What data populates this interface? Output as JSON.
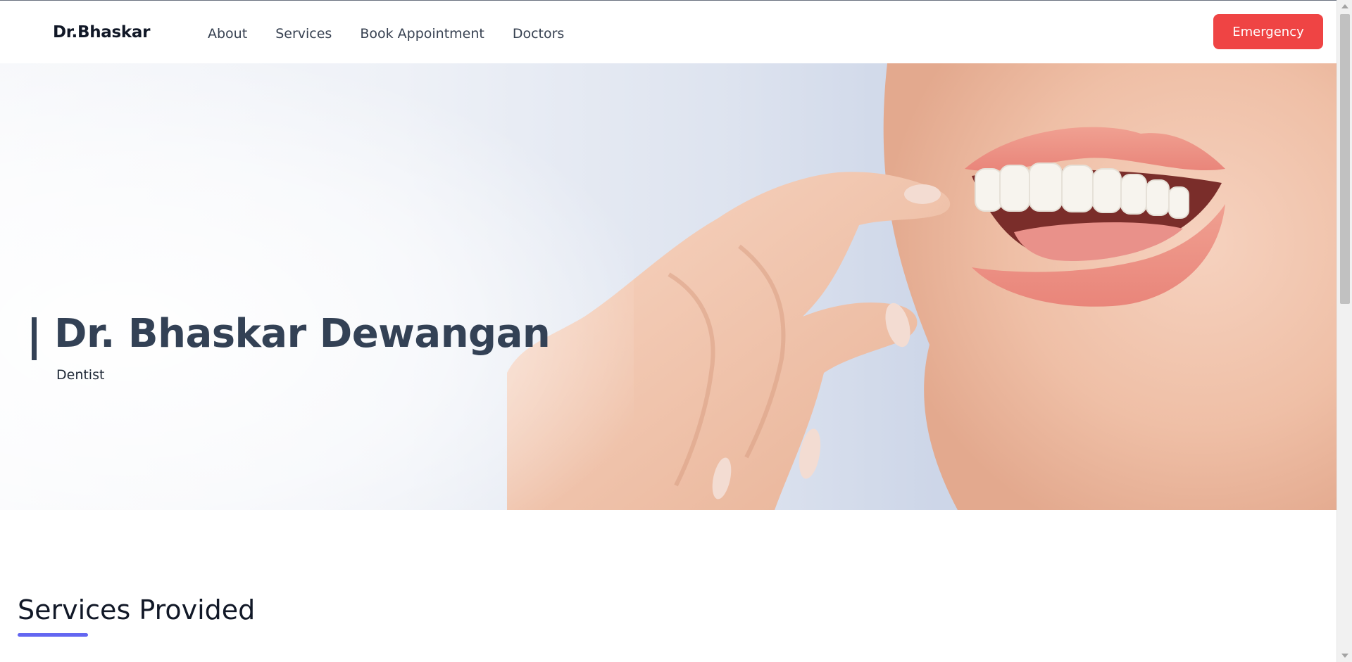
{
  "nav": {
    "brand": "Dr.Bhaskar",
    "links": [
      "About",
      "Services",
      "Book Appointment",
      "Doctors"
    ],
    "emergency_label": "Emergency"
  },
  "hero": {
    "title": "Dr. Bhaskar Dewangan",
    "subtitle": "Dentist",
    "image_icon": "smiling-mouth-with-clear-aligner-photo"
  },
  "services": {
    "title": "Services Provided"
  },
  "colors": {
    "emergency": "#ef4444",
    "accent_underline": "#6366f1",
    "hero_text": "#334155"
  }
}
